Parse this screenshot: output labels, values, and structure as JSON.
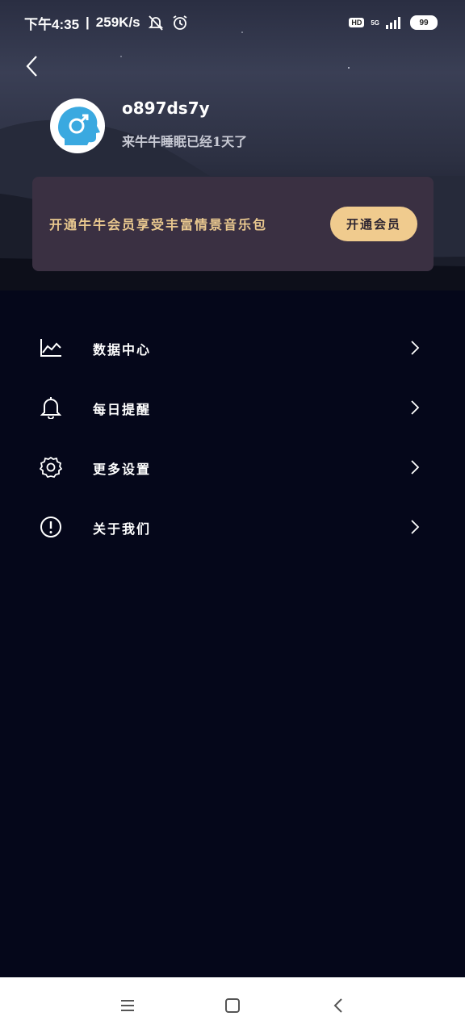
{
  "status_bar": {
    "time": "下午4:35",
    "net_speed": "259K/s",
    "network": "5G",
    "battery": "99",
    "hd": "HD"
  },
  "profile": {
    "username": "o897ds7y",
    "sleep_days": "来牛牛睡眠已经1天了"
  },
  "vip": {
    "promo_text": "开通牛牛会员享受丰富情景音乐包",
    "button_label": "开通会员"
  },
  "menu": {
    "items": [
      {
        "label": "数据中心",
        "icon": "chart-icon"
      },
      {
        "label": "每日提醒",
        "icon": "bell-icon"
      },
      {
        "label": "更多设置",
        "icon": "gear-icon"
      },
      {
        "label": "关于我们",
        "icon": "info-icon"
      }
    ]
  },
  "colors": {
    "background": "#05071a",
    "accent_gold": "#f0cb8e",
    "card_bg": "#3a3042",
    "avatar_blue": "#3aa9e0"
  }
}
